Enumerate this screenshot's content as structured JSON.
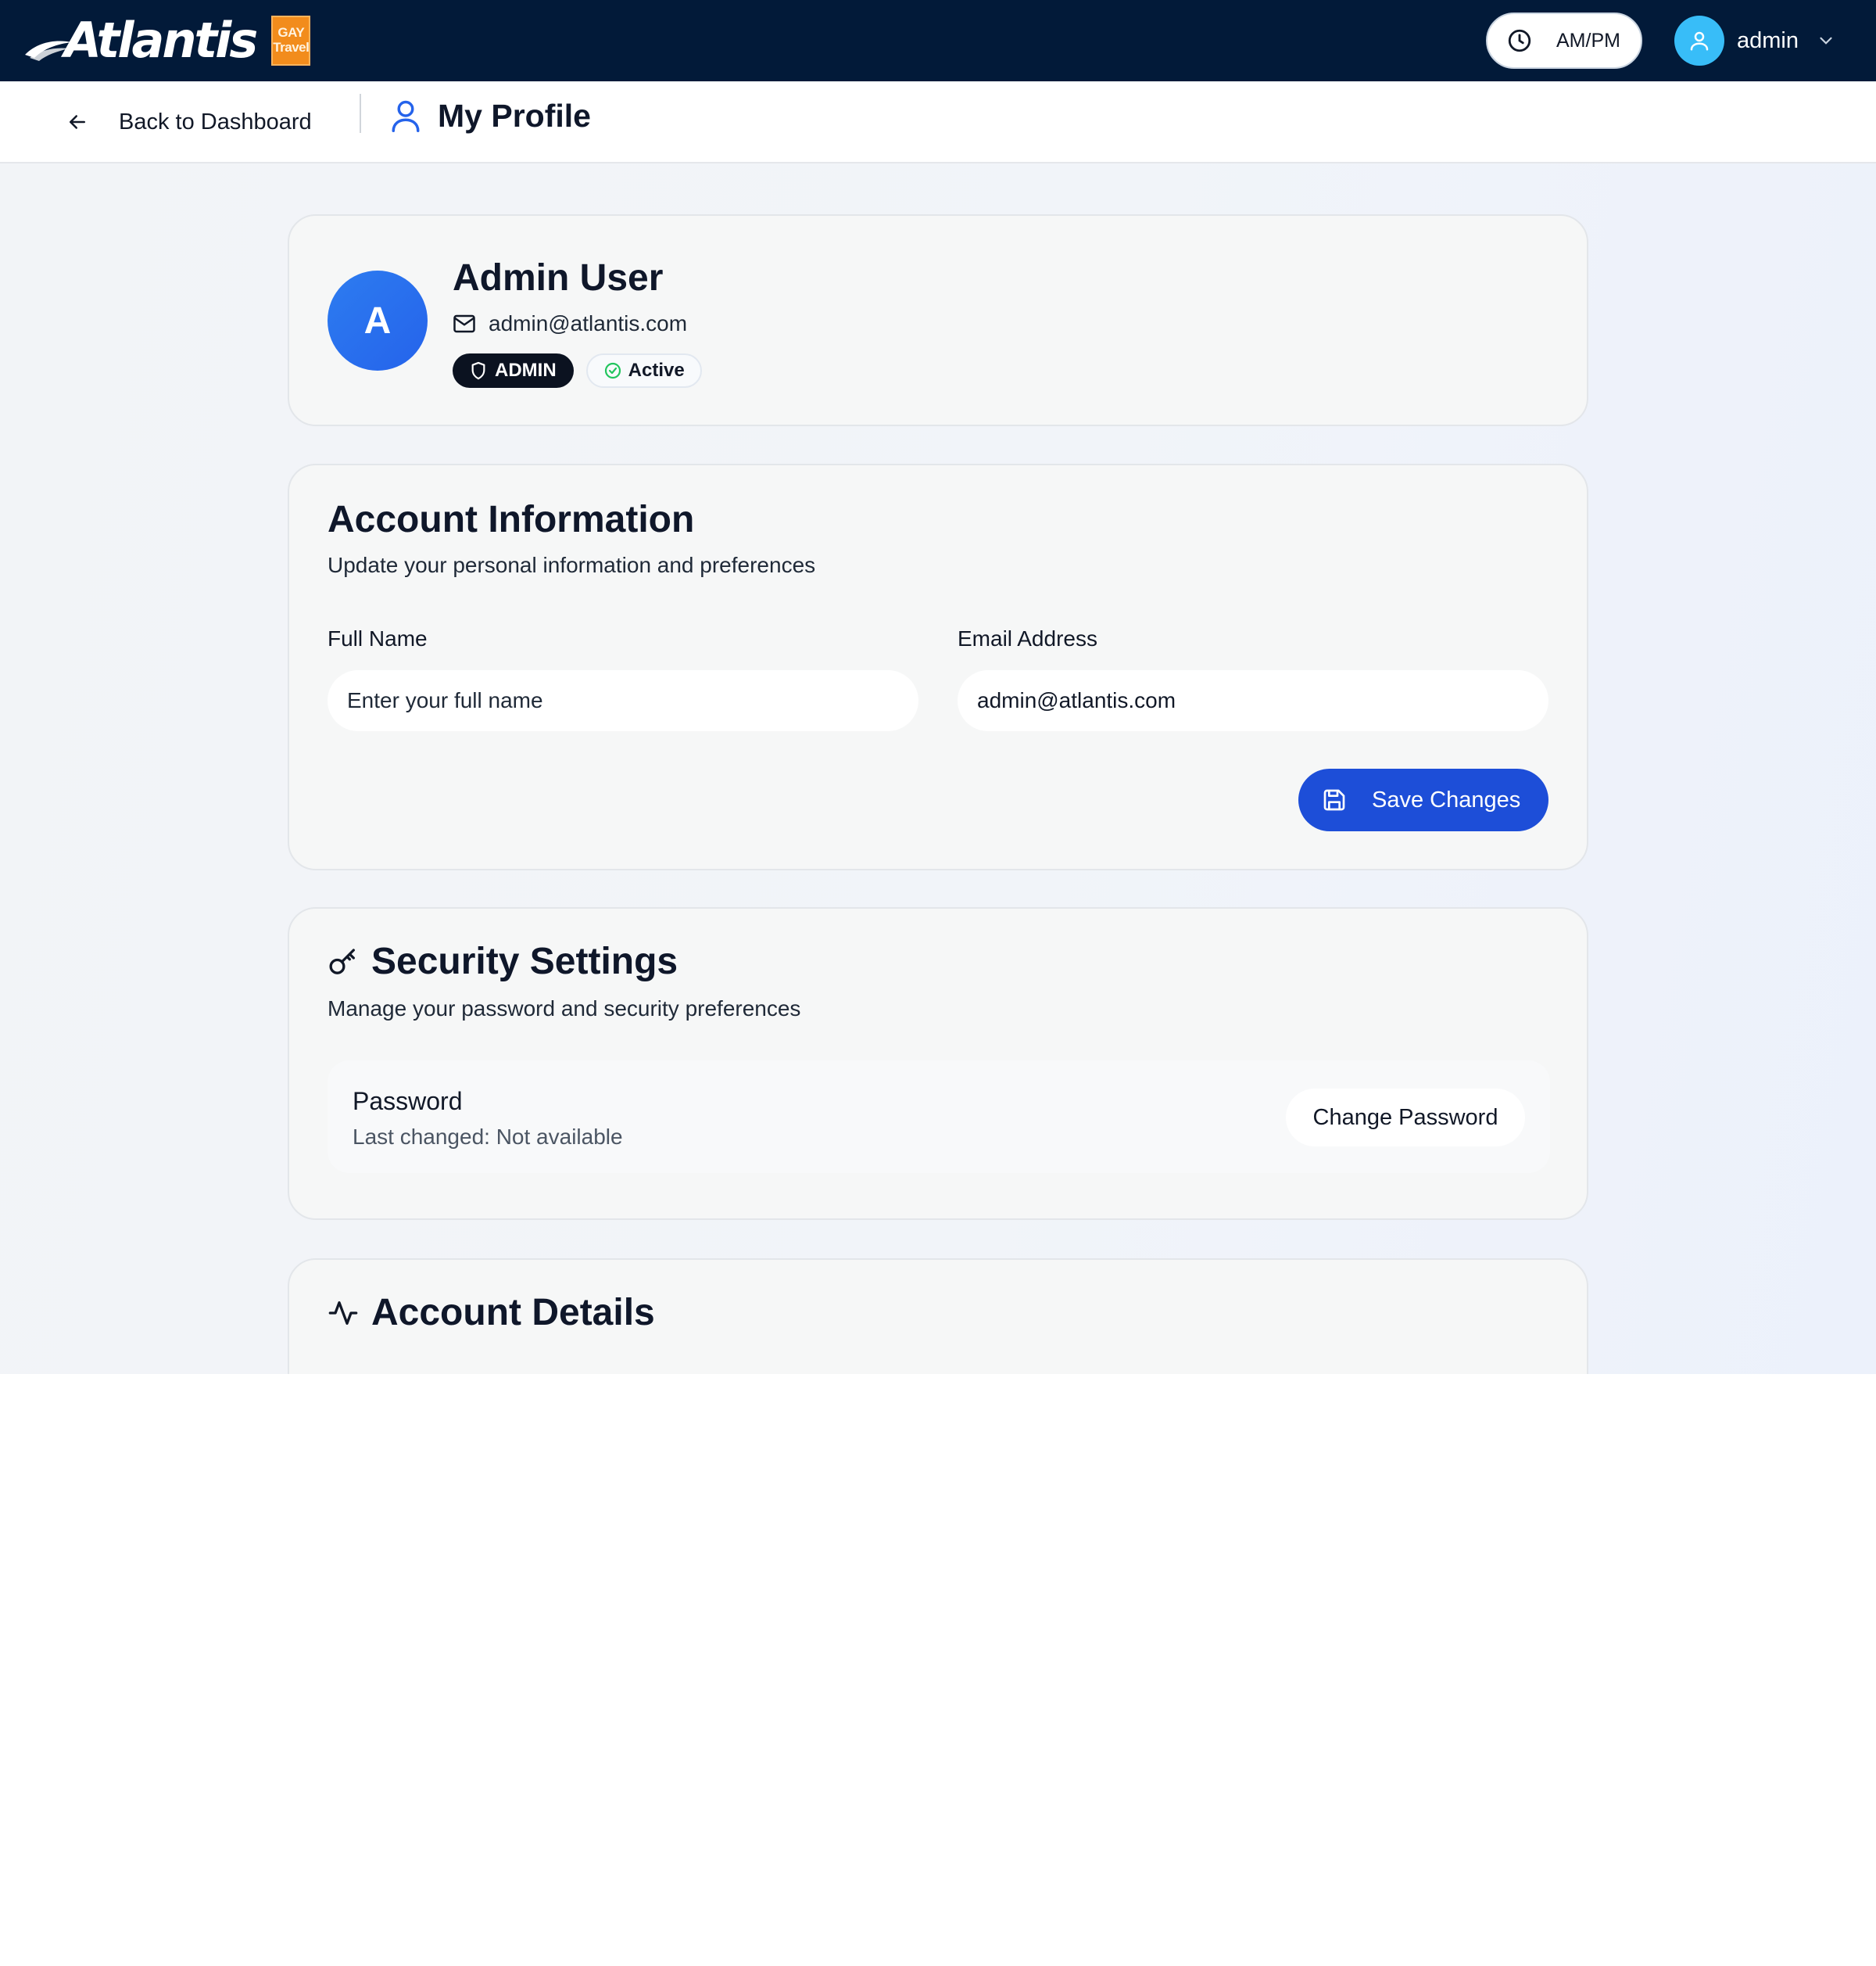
{
  "header": {
    "brand": "Atlantis",
    "badge_lines": [
      "GAY",
      "Travel"
    ],
    "time_format_label": "AM/PM",
    "username": "admin"
  },
  "subheader": {
    "back_label": "Back to Dashboard",
    "page_title": "My Profile"
  },
  "profile": {
    "avatar_initial": "A",
    "name": "Admin User",
    "email": "admin@atlantis.com",
    "role_badge": "ADMIN",
    "status_badge": "Active"
  },
  "account_info": {
    "title": "Account Information",
    "subtitle": "Update your personal information and preferences",
    "full_name_label": "Full Name",
    "full_name_placeholder": "Enter your full name",
    "full_name_value": "",
    "email_label": "Email Address",
    "email_value": "admin@atlantis.com",
    "save_label": "Save Changes"
  },
  "security": {
    "title": "Security Settings",
    "subtitle": "Manage your password and security preferences",
    "password_title": "Password",
    "password_sub": "Last changed: Not available",
    "change_password_label": "Change Password"
  },
  "account_details": {
    "title": "Account Details"
  },
  "colors": {
    "topbar_bg": "#021a39",
    "accent_blue": "#1d4ed8",
    "badge_orange": "#f28c1c",
    "status_green": "#22c55e",
    "avatar_light_blue": "#38bdf8"
  },
  "icons": {
    "clock": "clock-icon",
    "user": "user-icon",
    "chevron": "chevron-down-icon",
    "back": "arrow-left-icon",
    "mail": "mail-icon",
    "shield": "shield-icon",
    "check": "check-circle-icon",
    "save": "save-icon",
    "key": "key-icon",
    "activity": "activity-icon"
  }
}
